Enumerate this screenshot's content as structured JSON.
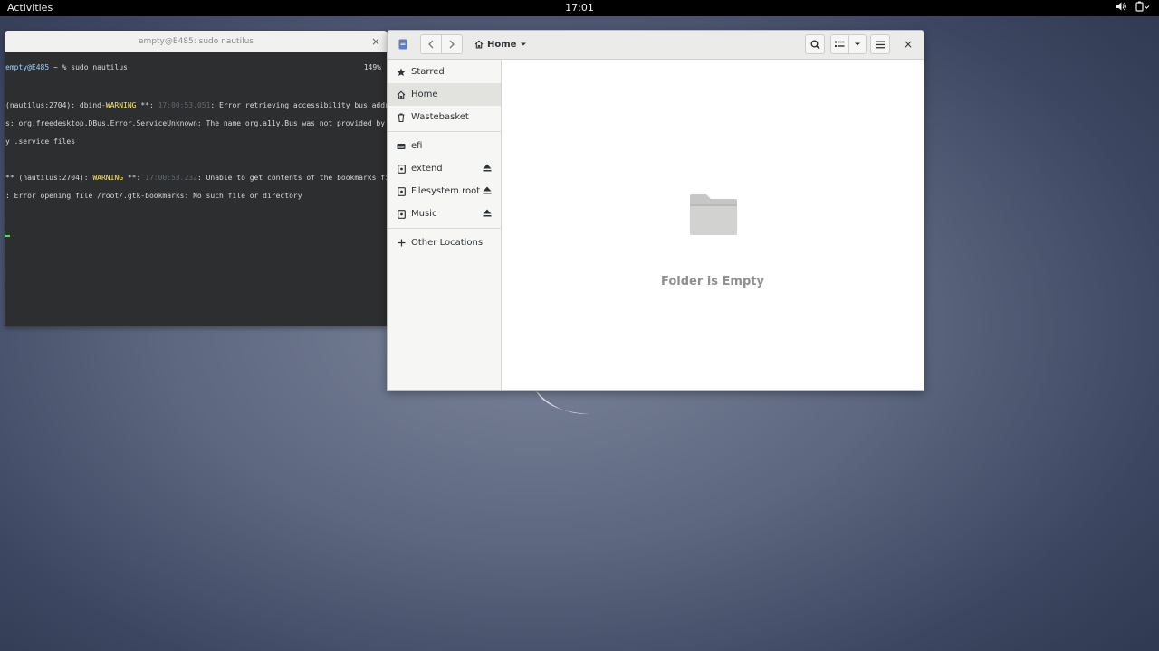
{
  "topbar": {
    "activities": "Activities",
    "clock": "17:01",
    "icons": [
      "volume-icon",
      "battery-icon"
    ]
  },
  "terminal": {
    "title": "empty@E485: sudo nautilus",
    "close": "×",
    "percent": "149%",
    "prompt_user": "empty@E485",
    "prompt_rest": " ~ % sudo nautilus",
    "line1_a": "(nautilus:2704): dbind-",
    "line1_warn": "WARNING",
    "line1_b": " **: ",
    "line1_time": "17:00:53.051",
    "line1_c": ": Error retrieving accessibility bus addres",
    "line2": "s: org.freedesktop.DBus.Error.ServiceUnknown: The name org.a11y.Bus was not provided by an",
    "line3": "y .service files",
    "line4_a": "** (nautilus:2704): ",
    "line4_warn": "WARNING",
    "line4_b": " **: ",
    "line4_time": "17:00:53.232",
    "line4_c": ": Unable to get contents of the bookmarks file",
    "line5": ": Error opening file /root/.gtk-bookmarks: No such file or directory"
  },
  "files": {
    "path": "Home",
    "close": "×",
    "sidebar": {
      "starred": "Starred",
      "home": "Home",
      "wastebasket": "Wastebasket",
      "efi": "efi",
      "extend": "extend",
      "filesystem_root": "Filesystem root",
      "music": "Music",
      "other_locations": "Other Locations"
    },
    "empty_message": "Folder is Empty"
  }
}
